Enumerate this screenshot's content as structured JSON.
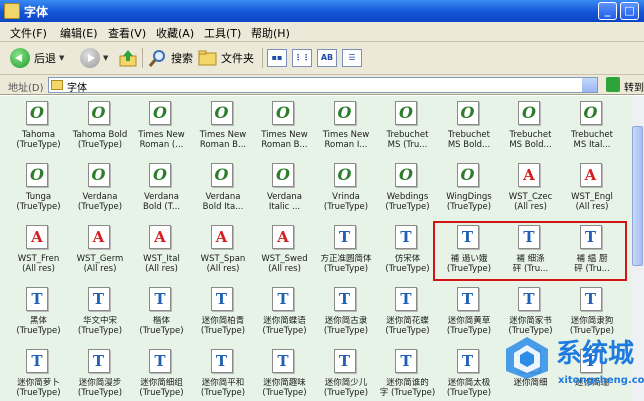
{
  "window": {
    "title": "字体"
  },
  "menu": [
    "文件(F)",
    "编辑(E)",
    "查看(V)",
    "收藏(A)",
    "工具(T)",
    "帮助(H)"
  ],
  "toolbar": {
    "back_label": "后退",
    "search_label": "搜索",
    "folders_label": "文件夹"
  },
  "address": {
    "label": "地址(D)",
    "value": "字体",
    "go_label": "转到"
  },
  "fonts": [
    {
      "name": "Tahoma",
      "type": "(TrueType)",
      "icon": "o"
    },
    {
      "name": "Tahoma Bold",
      "type": "(TrueType)",
      "icon": "o"
    },
    {
      "name": "Times New",
      "type": "Roman (...",
      "icon": "o"
    },
    {
      "name": "Times New",
      "type": "Roman B...",
      "icon": "o"
    },
    {
      "name": "Times New",
      "type": "Roman B...",
      "icon": "o"
    },
    {
      "name": "Times New",
      "type": "Roman I...",
      "icon": "o"
    },
    {
      "name": "Trebuchet",
      "type": "MS (Tru...",
      "icon": "o"
    },
    {
      "name": "Trebuchet",
      "type": "MS Bold...",
      "icon": "o"
    },
    {
      "name": "Trebuchet",
      "type": "MS Bold...",
      "icon": "o"
    },
    {
      "name": "Trebuchet",
      "type": "MS Ital...",
      "icon": "o"
    },
    {
      "name": "Tunga",
      "type": "(TrueType)",
      "icon": "o"
    },
    {
      "name": "Verdana",
      "type": "(TrueType)",
      "icon": "o"
    },
    {
      "name": "Verdana",
      "type": "Bold (T...",
      "icon": "o"
    },
    {
      "name": "Verdana",
      "type": "Bold Ita...",
      "icon": "o"
    },
    {
      "name": "Verdana",
      "type": "Italic ...",
      "icon": "o"
    },
    {
      "name": "Vrinda",
      "type": "(TrueType)",
      "icon": "o"
    },
    {
      "name": "Webdings",
      "type": "(TrueType)",
      "icon": "o"
    },
    {
      "name": "WingDings",
      "type": "(TrueType)",
      "icon": "o"
    },
    {
      "name": "WST_Czec",
      "type": "(All res)",
      "icon": "a"
    },
    {
      "name": "WST_Engl",
      "type": "(All res)",
      "icon": "a"
    },
    {
      "name": "WST_Fren",
      "type": "(All res)",
      "icon": "a"
    },
    {
      "name": "WST_Germ",
      "type": "(All res)",
      "icon": "a"
    },
    {
      "name": "WST_Ital",
      "type": "(All res)",
      "icon": "a"
    },
    {
      "name": "WST_Span",
      "type": "(All res)",
      "icon": "a"
    },
    {
      "name": "WST_Swed",
      "type": "(All res)",
      "icon": "a"
    },
    {
      "name": "方正准圆简体",
      "type": "(TrueType)",
      "icon": "t"
    },
    {
      "name": "仿宋体",
      "type": "(TrueType)",
      "icon": "t"
    },
    {
      "name": "補 遢い娥",
      "type": "(TrueType)",
      "icon": "t"
    },
    {
      "name": "補 细涤",
      "type": "砰 (Tru...",
      "icon": "t"
    },
    {
      "name": "補 緼 厨",
      "type": "砰 (Tru...",
      "icon": "t"
    },
    {
      "name": "黑体",
      "type": "(TrueType)",
      "icon": "t"
    },
    {
      "name": "华文中宋",
      "type": "(TrueType)",
      "icon": "t"
    },
    {
      "name": "楷体",
      "type": "(TrueType)",
      "icon": "t"
    },
    {
      "name": "迷你简柏青",
      "type": "(TrueType)",
      "icon": "t"
    },
    {
      "name": "迷你简蝶语",
      "type": "(TrueType)",
      "icon": "t"
    },
    {
      "name": "迷你简古隶",
      "type": "(TrueType)",
      "icon": "t"
    },
    {
      "name": "迷你简花蝶",
      "type": "(TrueType)",
      "icon": "t"
    },
    {
      "name": "迷你简黄草",
      "type": "(TrueType)",
      "icon": "t"
    },
    {
      "name": "迷你简家书",
      "type": "(TrueType)",
      "icon": "t"
    },
    {
      "name": "迷你简隶狗",
      "type": "(TrueType)",
      "icon": "t"
    },
    {
      "name": "迷你简萝卜",
      "type": "(TrueType)",
      "icon": "t"
    },
    {
      "name": "迷你简漫步",
      "type": "(TrueType)",
      "icon": "t"
    },
    {
      "name": "迷你简细组",
      "type": "(TrueType)",
      "icon": "t"
    },
    {
      "name": "迷你简平和",
      "type": "(TrueType)",
      "icon": "t"
    },
    {
      "name": "迷你简趣味",
      "type": "(TrueType)",
      "icon": "t"
    },
    {
      "name": "迷你简少儿",
      "type": "(TrueType)",
      "icon": "t"
    },
    {
      "name": "迷你简谁的",
      "type": "字 (TrueType)",
      "icon": "t"
    },
    {
      "name": "迷你简太极",
      "type": "(TrueType)",
      "icon": "t"
    },
    {
      "name": "迷你简细",
      "type": "",
      "icon": "t"
    },
    {
      "name": "迷你简瑞",
      "type": "",
      "icon": "t"
    }
  ],
  "watermark": {
    "brand": "系统城",
    "url": "xitongcheng.com"
  }
}
